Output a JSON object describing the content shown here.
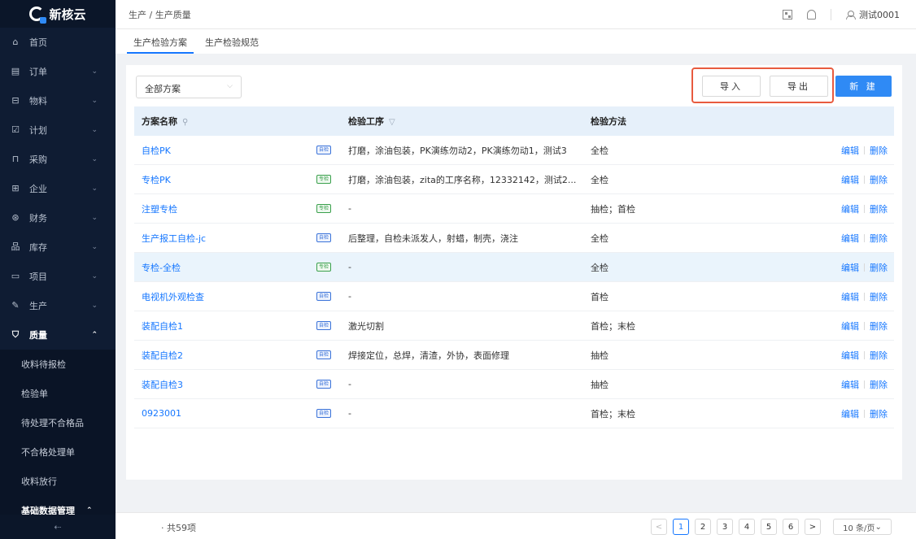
{
  "brand": {
    "name": "新核云"
  },
  "sidebar": {
    "items": [
      {
        "label": "首页",
        "icon": "home-icon",
        "glyph": "⌂"
      },
      {
        "label": "订单",
        "icon": "order-icon",
        "glyph": "▤"
      },
      {
        "label": "物料",
        "icon": "material-icon",
        "glyph": "⊟"
      },
      {
        "label": "计划",
        "icon": "plan-icon",
        "glyph": "☑"
      },
      {
        "label": "采购",
        "icon": "purchase-icon",
        "glyph": "⊓"
      },
      {
        "label": "企业",
        "icon": "enterprise-icon",
        "glyph": "⊞"
      },
      {
        "label": "财务",
        "icon": "finance-icon",
        "glyph": "⊛"
      },
      {
        "label": "库存",
        "icon": "inventory-icon",
        "glyph": "品"
      },
      {
        "label": "项目",
        "icon": "project-icon",
        "glyph": "▭"
      },
      {
        "label": "生产",
        "icon": "wrench-icon",
        "glyph": "✎"
      },
      {
        "label": "质量",
        "icon": "shield-icon",
        "glyph": "⛉"
      }
    ],
    "sub_items": [
      "收料待报检",
      "检验单",
      "待处理不合格品",
      "不合格处理单",
      "收料放行"
    ],
    "basic_data": "基础数据管理",
    "chevron_down": "⌄",
    "chevron_up": "⌃",
    "collapse": "⇠"
  },
  "header": {
    "breadcrumb": "生产 / 生产质量",
    "user": "测试0001"
  },
  "tabs": [
    "生产检验方案",
    "生产检验规范"
  ],
  "toolbar": {
    "filter_value": "全部方案",
    "filter_arrow": "⌵",
    "import_label": "导入",
    "export_label": "导出",
    "new_label": "新 建"
  },
  "table": {
    "headers": {
      "name": "方案名称",
      "process": "检验工序",
      "method": "检验方法"
    },
    "search_glyph": "⚲",
    "filter_glyph": "▽",
    "rows": [
      {
        "name": "自检PK",
        "tag": "自检",
        "tag_type": "self",
        "process": "打磨，涂油包装，PK演练勿动2，PK演练勿动1，测试3",
        "method": "全检"
      },
      {
        "name": "专检PK",
        "tag": "专检",
        "tag_type": "spec",
        "process": "打磨，涂油包装，zita的工序名称，12332142，测试2...",
        "method": "全检"
      },
      {
        "name": "注塑专检",
        "tag": "专检",
        "tag_type": "spec",
        "process": "-",
        "method": "抽检；首检"
      },
      {
        "name": "生产报工自检-jc",
        "tag": "自检",
        "tag_type": "self",
        "process": "后整理，自检未派发人，射蜡，制壳，浇注",
        "method": "全检"
      },
      {
        "name": "专检-全检",
        "tag": "专检",
        "tag_type": "spec",
        "process": "-",
        "method": "全检"
      },
      {
        "name": "电视机外观检查",
        "tag": "自检",
        "tag_type": "self",
        "process": "-",
        "method": "首检"
      },
      {
        "name": "装配自检1",
        "tag": "自检",
        "tag_type": "self",
        "process": "激光切割",
        "method": "首检；末检"
      },
      {
        "name": "装配自检2",
        "tag": "自检",
        "tag_type": "self",
        "process": "焊接定位，总焊，清渣，外协，表面修理",
        "method": "抽检"
      },
      {
        "name": "装配自检3",
        "tag": "自检",
        "tag_type": "self",
        "process": "-",
        "method": "抽检"
      },
      {
        "name": "0923001",
        "tag": "自检",
        "tag_type": "self",
        "process": "-",
        "method": "首检；末检"
      }
    ],
    "edit_label": "编辑",
    "delete_label": "删除"
  },
  "footer": {
    "total": "· 共59项",
    "prev": "<",
    "next": ">",
    "pages": [
      "1",
      "2",
      "3",
      "4",
      "5",
      "6"
    ],
    "current_page": "1",
    "page_size": "10 条/页",
    "page_size_arrow": "⌄"
  },
  "colors": {
    "accent": "#1677ff",
    "highlight_box": "#e85b3f",
    "sidebar_bg": "#0f1c33"
  }
}
